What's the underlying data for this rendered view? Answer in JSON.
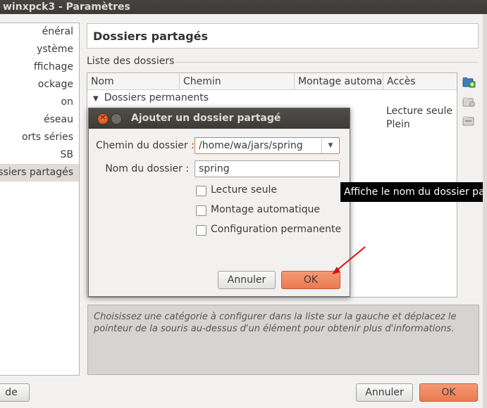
{
  "window": {
    "title": "winxpck3 - Paramètres"
  },
  "sidebar": {
    "items": [
      {
        "label": "énéral"
      },
      {
        "label": "ystème"
      },
      {
        "label": "ffichage"
      },
      {
        "label": "ockage"
      },
      {
        "label": "on"
      },
      {
        "label": "éseau"
      },
      {
        "label": "orts séries"
      },
      {
        "label": "SB"
      },
      {
        "label": "ossiers partagés"
      }
    ],
    "selected_index": 8
  },
  "page": {
    "title": "Dossiers partagés",
    "section_label": "Liste des dossiers"
  },
  "table": {
    "columns": [
      "Nom",
      "Chemin",
      "Montage automati",
      "Accès"
    ],
    "root": "Dossiers permanents",
    "acces_values": [
      "Lecture seule",
      "Plein"
    ]
  },
  "side_icons": [
    "add-folder-icon",
    "edit-folder-icon",
    "remove-folder-icon"
  ],
  "hint": "Choisissez une catégorie à configurer dans la liste sur la gauche et déplacez le pointeur de la souris au-dessus d'un élément pour obtenir plus d'informations.",
  "bottom": {
    "left_partial_label": "de",
    "cancel_label": "Annuler",
    "ok_label": "OK"
  },
  "dialog": {
    "title": "Ajouter un dossier partagé",
    "path_label": "Chemin du dossier :",
    "path_value": "/home/wa/jars/spring",
    "name_label": "Nom du dossier :",
    "name_value": "spring",
    "checkboxes": [
      {
        "label": "Lecture seule",
        "checked": false
      },
      {
        "label": "Montage automatique",
        "checked": false
      },
      {
        "label": "Configuration permanente",
        "checked": false
      }
    ],
    "cancel_label": "Annuler",
    "ok_label": "OK"
  },
  "tooltip": "Affiche le nom du dossier partagé",
  "colors": {
    "accent": "#ec7a4f",
    "titlebar": "#3c3b37",
    "arrow": "#e01010"
  }
}
